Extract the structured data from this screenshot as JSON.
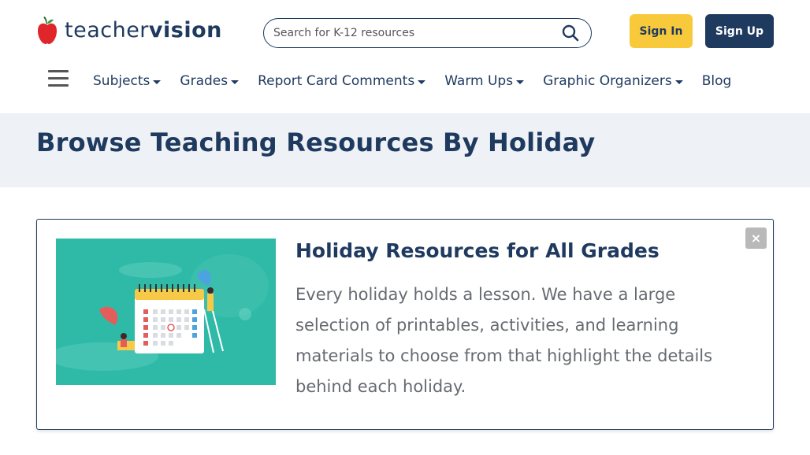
{
  "header": {
    "logo": {
      "text_light": "teacher",
      "text_bold": "vision",
      "icon": "apple-icon"
    },
    "search": {
      "placeholder": "Search for K-12 resources",
      "value": "",
      "icon": "search-icon"
    },
    "sign_in_label": "Sign In",
    "sign_up_label": "Sign Up"
  },
  "nav": {
    "menu_icon": "hamburger-menu-icon",
    "items": [
      {
        "label": "Subjects",
        "dropdown": true
      },
      {
        "label": "Grades",
        "dropdown": true
      },
      {
        "label": "Report Card Comments",
        "dropdown": true
      },
      {
        "label": "Warm Ups",
        "dropdown": true
      },
      {
        "label": "Graphic Organizers",
        "dropdown": true
      },
      {
        "label": "Blog",
        "dropdown": false
      }
    ]
  },
  "page": {
    "title": "Browse Teaching Resources By Holiday"
  },
  "card": {
    "title": "Holiday Resources for All Grades",
    "description": "Every holiday holds a lesson. We have a large selection of printables, activities, and learning materials to choose from that highlight the details behind each holiday.",
    "close_icon": "close-icon",
    "close_label": "×"
  },
  "colors": {
    "brand_navy": "#1f3a5f",
    "signin_yellow": "#f8c93a",
    "band_bg": "#eef1f6",
    "illustration_teal": "#2fbaa7",
    "apple_red": "#e0252b"
  }
}
